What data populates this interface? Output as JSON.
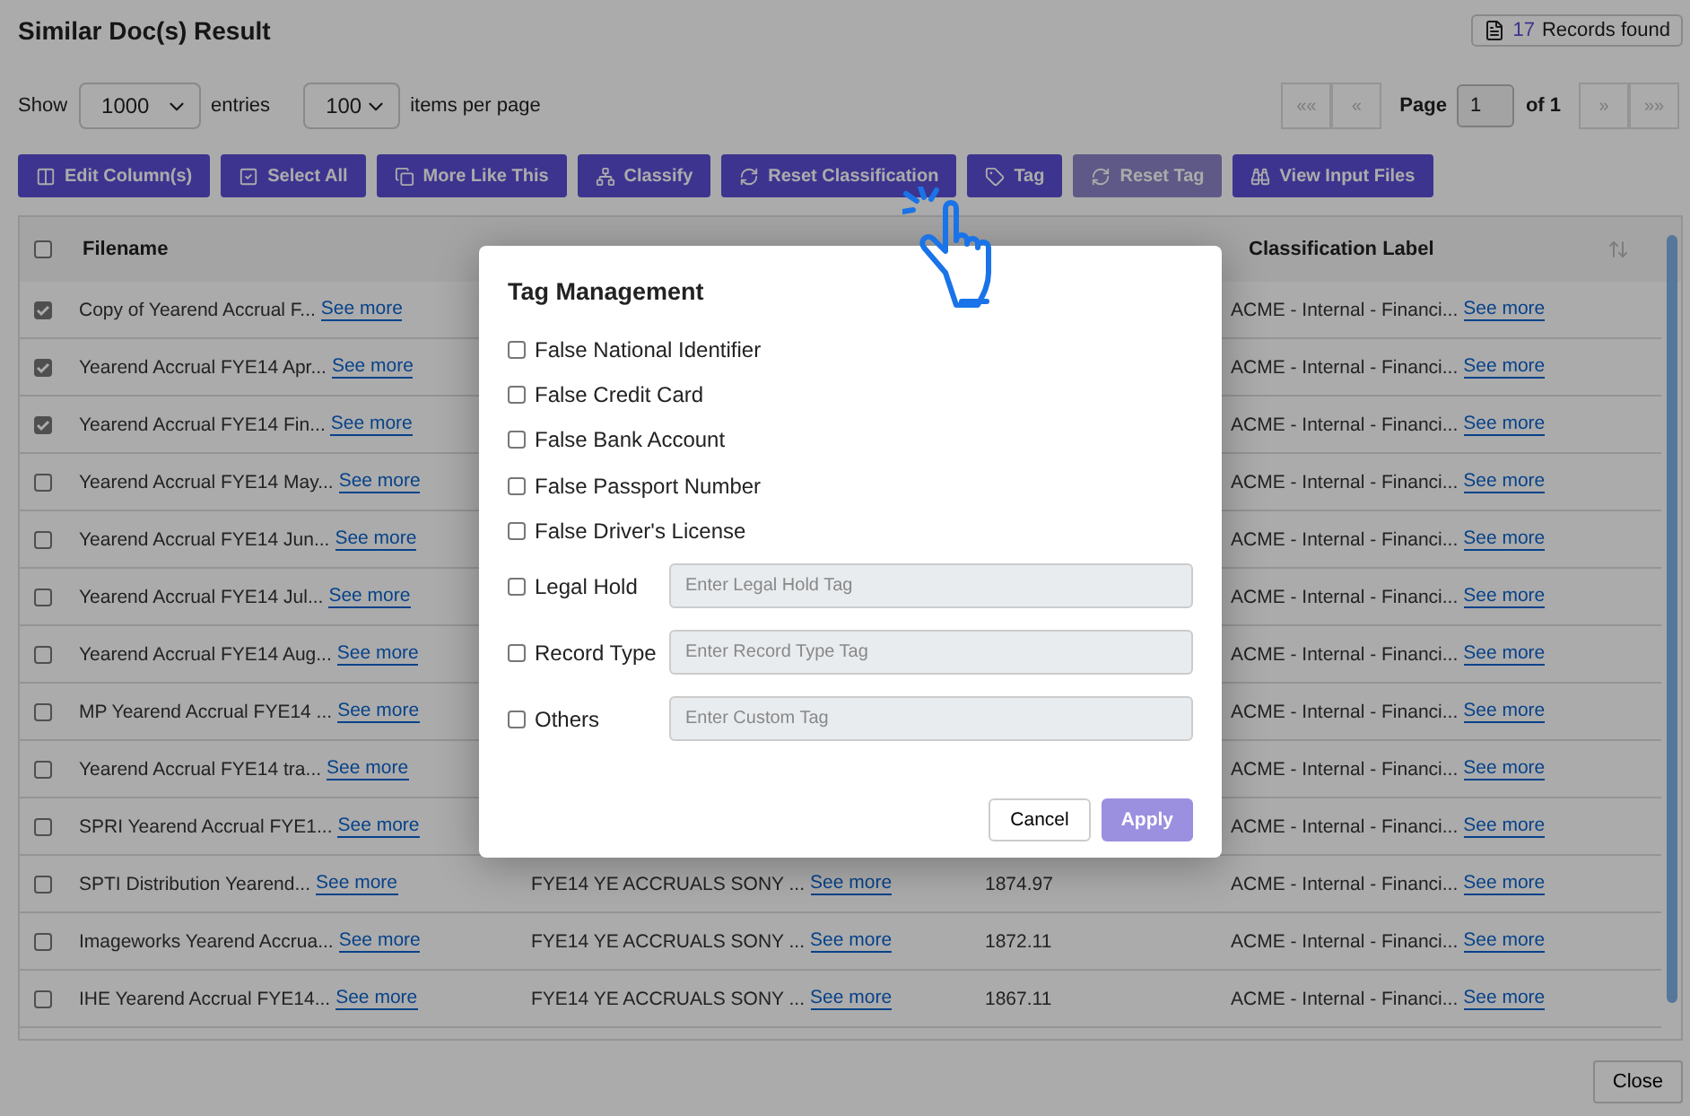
{
  "title": "Similar Doc(s) Result",
  "records": {
    "count": "17",
    "label": "Records found"
  },
  "entries": {
    "show_label": "Show",
    "value": "1000",
    "entries_label": "entries",
    "per_page_value": "100",
    "per_page_label": "items per page"
  },
  "pagination": {
    "first": "««",
    "prev": "«",
    "page_label": "Page",
    "page_value": "1",
    "of_label": "of 1",
    "next": "»",
    "last": "»»",
    "first_disabled": true,
    "next_disabled": true
  },
  "toolbar": [
    {
      "label": "Edit Column(s)",
      "disabled": false
    },
    {
      "label": "Select All",
      "disabled": false
    },
    {
      "label": "More Like This",
      "disabled": false
    },
    {
      "label": "Classify",
      "disabled": false
    },
    {
      "label": "Reset Classification",
      "disabled": false
    },
    {
      "label": "Tag",
      "disabled": false
    },
    {
      "label": "Reset Tag",
      "disabled": true
    },
    {
      "label": "View Input Files",
      "disabled": false
    }
  ],
  "table": {
    "select_all_checked": false,
    "columns": [
      "Filename",
      "Classification Label"
    ],
    "rows": [
      {
        "checked": true,
        "filename": "Copy of Yearend Accrual F...",
        "link": "See more",
        "classification": "ACME - Internal - Financi...",
        "class_link": "See more"
      },
      {
        "checked": true,
        "filename": "Yearend Accrual FYE14 Apr...",
        "link": "See more",
        "classification": "ACME - Internal - Financi...",
        "class_link": "See more"
      },
      {
        "checked": true,
        "filename": "Yearend Accrual FYE14 Fin...",
        "link": "See more",
        "classification": "ACME - Internal - Financi...",
        "class_link": "See more"
      },
      {
        "checked": false,
        "filename": "Yearend Accrual FYE14 May...",
        "link": "See more",
        "classification": "ACME - Internal - Financi...",
        "class_link": "See more"
      },
      {
        "checked": false,
        "filename": "Yearend Accrual FYE14 Jun...",
        "link": "See more",
        "classification": "ACME - Internal - Financi...",
        "class_link": "See more"
      },
      {
        "checked": false,
        "filename": "Yearend Accrual FYE14 Jul...",
        "link": "See more",
        "classification": "ACME - Internal - Financi...",
        "class_link": "See more"
      },
      {
        "checked": false,
        "filename": "Yearend Accrual FYE14 Aug...",
        "link": "See more",
        "classification": "ACME - Internal - Financi...",
        "class_link": "See more"
      },
      {
        "checked": false,
        "filename": "MP Yearend Accrual FYE14 ...",
        "link": "See more",
        "classification": "ACME - Internal - Financi...",
        "class_link": "See more"
      },
      {
        "checked": false,
        "filename": "Yearend Accrual FYE14 tra...",
        "link": "See more",
        "classification": "ACME - Internal - Financi...",
        "class_link": "See more"
      },
      {
        "checked": false,
        "filename": "SPRI Yearend Accrual FYE1...",
        "link": "See more",
        "classification": "ACME - Internal - Financi...",
        "class_link": "See more"
      },
      {
        "checked": false,
        "filename": "SPTI Distribution Yearend...",
        "link": "See more",
        "column_2": "FYE14 YE ACCRUALS SONY ...",
        "column_2_link": "See more",
        "column_3": "1874.97",
        "classification": "ACME - Internal - Financi...",
        "class_link": "See more"
      },
      {
        "checked": false,
        "filename": "Imageworks Yearend Accrua...",
        "link": "See more",
        "column_2": "FYE14 YE ACCRUALS SONY ...",
        "column_2_link": "See more",
        "column_3": "1872.11",
        "classification": "ACME - Internal - Financi...",
        "class_link": "See more"
      },
      {
        "checked": false,
        "filename": "IHE Yearend Accrual FYE14...",
        "link": "See more",
        "column_2": "FYE14 YE ACCRUALS SONY ...",
        "column_2_link": "See more",
        "column_3": "1867.11",
        "classification": "ACME - Internal - Financi...",
        "class_link": "See more"
      }
    ]
  },
  "close_button": "Close",
  "dialog": {
    "title": "Tag Management",
    "options": [
      {
        "kind": "checkbox",
        "label": "False National Identifier",
        "checked": false
      },
      {
        "kind": "checkbox",
        "label": "False Credit Card",
        "checked": false
      },
      {
        "kind": "checkbox",
        "label": "False Bank Account",
        "checked": false
      },
      {
        "kind": "checkbox",
        "label": "False Passport Number",
        "checked": false
      },
      {
        "kind": "checkbox",
        "label": "False Driver's License",
        "checked": false
      },
      {
        "kind": "input",
        "label": "Legal Hold",
        "checked": false,
        "placeholder": "Enter Legal Hold Tag"
      },
      {
        "kind": "input",
        "label": "Record Type",
        "checked": false,
        "placeholder": "Enter Record Type Tag"
      },
      {
        "kind": "input",
        "label": "Others",
        "checked": false,
        "placeholder": "Enter Custom Tag"
      }
    ],
    "cancel": "Cancel",
    "apply": "Apply"
  }
}
